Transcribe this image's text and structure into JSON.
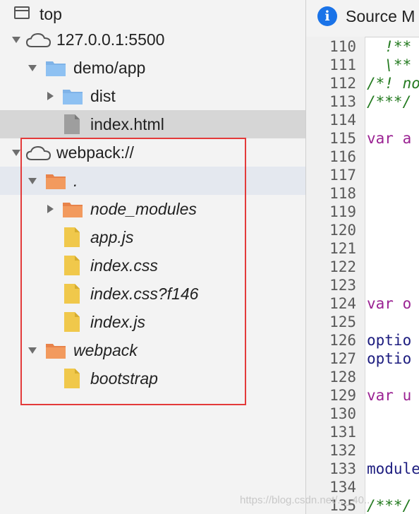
{
  "tree": {
    "top_label": "top",
    "origin_label": "127.0.0.1:5500",
    "demo_folder": "demo/app",
    "dist_folder": "dist",
    "index_html": "index.html",
    "webpack_origin": "webpack://",
    "dot_folder": ".",
    "node_modules": "node_modules",
    "app_js": "app.js",
    "index_css": "index.css",
    "index_css_hash": "index.css?f146",
    "index_js": "index.js",
    "webpack_folder": "webpack",
    "bootstrap": "bootstrap"
  },
  "editor": {
    "tab_title": "Source M",
    "lines": [
      {
        "n": "110",
        "text": "  !**",
        "cls": "comment"
      },
      {
        "n": "111",
        "text": "  \\**",
        "cls": "comment"
      },
      {
        "n": "112",
        "text": "/*! no",
        "cls": "comment"
      },
      {
        "n": "113",
        "text": "/***/",
        "cls": "comment"
      },
      {
        "n": "114",
        "text": "",
        "cls": ""
      },
      {
        "n": "115",
        "text": "var a",
        "cls": "keyword"
      },
      {
        "n": "116",
        "text": "",
        "cls": ""
      },
      {
        "n": "117",
        "text": "",
        "cls": ""
      },
      {
        "n": "118",
        "text": "",
        "cls": ""
      },
      {
        "n": "119",
        "text": "",
        "cls": ""
      },
      {
        "n": "120",
        "text": "",
        "cls": ""
      },
      {
        "n": "121",
        "text": "",
        "cls": ""
      },
      {
        "n": "122",
        "text": "",
        "cls": ""
      },
      {
        "n": "123",
        "text": "",
        "cls": ""
      },
      {
        "n": "124",
        "text": "var o",
        "cls": "keyword"
      },
      {
        "n": "125",
        "text": "",
        "cls": ""
      },
      {
        "n": "126",
        "text": "optio",
        "cls": "ident"
      },
      {
        "n": "127",
        "text": "optio",
        "cls": "ident"
      },
      {
        "n": "128",
        "text": "",
        "cls": ""
      },
      {
        "n": "129",
        "text": "var u",
        "cls": "keyword"
      },
      {
        "n": "130",
        "text": "",
        "cls": ""
      },
      {
        "n": "131",
        "text": "",
        "cls": ""
      },
      {
        "n": "132",
        "text": "",
        "cls": ""
      },
      {
        "n": "133",
        "text": "module",
        "cls": "ident"
      },
      {
        "n": "134",
        "text": "",
        "cls": ""
      },
      {
        "n": "135",
        "text": "/***/",
        "cls": "comment"
      }
    ]
  },
  "watermark": "https://blog.csdn.net/..._40..."
}
